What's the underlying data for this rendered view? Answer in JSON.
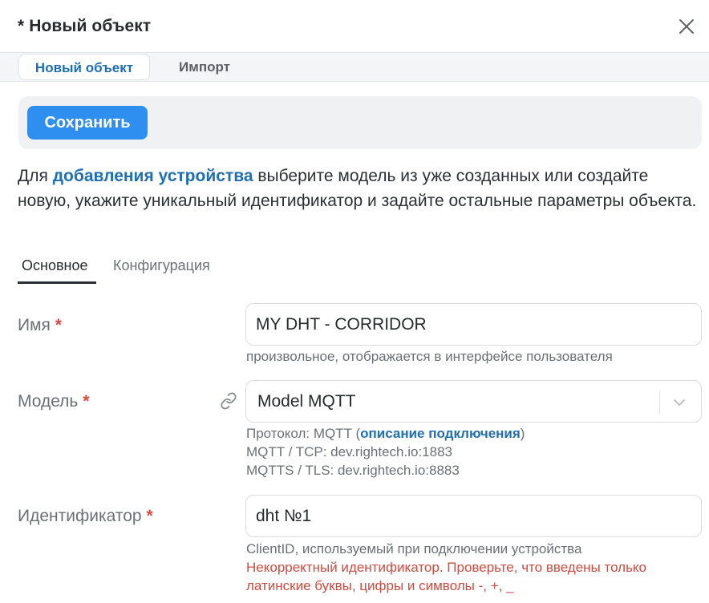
{
  "window": {
    "title": "* Новый объект"
  },
  "tabs": [
    {
      "label": "Новый объект",
      "active": true
    },
    {
      "label": "Импорт",
      "active": false
    }
  ],
  "toolbar": {
    "save_label": "Сохранить"
  },
  "intro": {
    "before": "Для ",
    "link": "добавления устройства",
    "after": " выберите модель из уже созданных или создайте новую, укажите уникальный идентификатор и задайте остальные параметры объекта."
  },
  "subtabs": [
    {
      "label": "Основное",
      "active": true
    },
    {
      "label": "Конфигурация",
      "active": false
    }
  ],
  "form": {
    "name": {
      "label": "Имя",
      "required_mark": "*",
      "value": "MY DHT - CORRIDOR",
      "hint": "произвольное, отображается в интерфейсе пользователя"
    },
    "model": {
      "label": "Модель",
      "required_mark": "*",
      "value": "Model MQTT",
      "protocol_prefix": "Протокол: MQTT (",
      "protocol_link": "описание подключения",
      "protocol_suffix": ")",
      "tcp": "MQTT / TCP: dev.rightech.io:1883",
      "tls": "MQTTS / TLS: dev.rightech.io:8883"
    },
    "identifier": {
      "label": "Идентификатор",
      "required_mark": "*",
      "value": "dht №1",
      "hint": "ClientID, используемый при подключении устройства",
      "error_line1": "Некорректный идентификатор. Проверьте, что введены только",
      "error_line2": "латинские буквы, цифры и символы -, +, _"
    }
  },
  "icons": {
    "close": "close-icon",
    "link": "link-icon",
    "chevron": "chevron-down-icon"
  },
  "colors": {
    "accent": "#2f8ff0",
    "link": "#1f6fb5",
    "error": "#cf4c40",
    "required": "#d94a3c"
  }
}
